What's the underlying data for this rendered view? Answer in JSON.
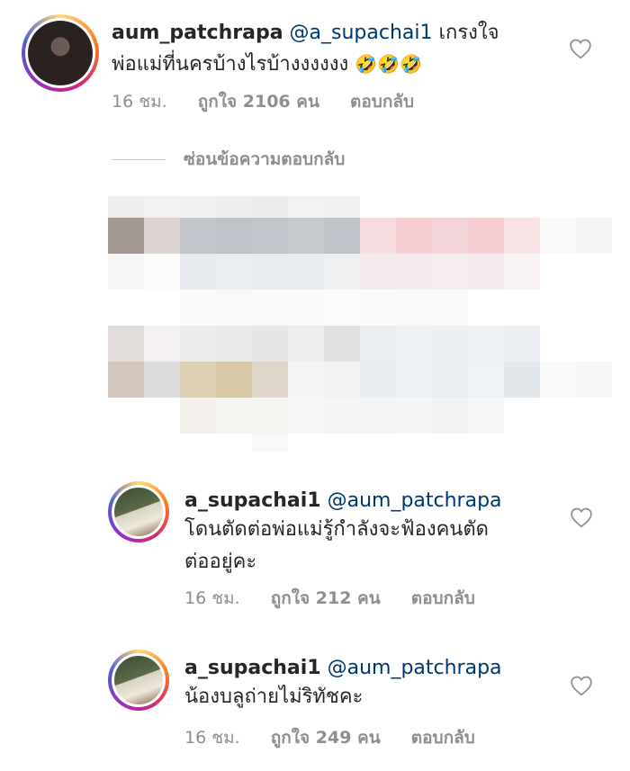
{
  "main_comment": {
    "username": "aum_patchrapa",
    "mention": "@a_supachai1",
    "text_line1": "เกรงใจ",
    "text_line2": "พ่อแม่ที่นครบ้างไรบ้างงงงงง",
    "emoji": "🤣🤣🤣",
    "time": "16 ชม.",
    "likes": "ถูกใจ 2106 คน",
    "reply_label": "ตอบกลับ"
  },
  "hide_replies_label": "ซ่อนข้อความตอบกลับ",
  "replies": [
    {
      "username": "a_supachai1",
      "mention": "@aum_patchrapa",
      "text_line1": "โดนตัดต่อพ่อแม่รู้กำลังจะฟ้องคนตัด",
      "text_line2": "ต่ออยู่คะ",
      "time": "16 ชม.",
      "likes": "ถูกใจ 212 คน",
      "reply_label": "ตอบกลับ"
    },
    {
      "username": "a_supachai1",
      "mention": "@aum_patchrapa",
      "text_line1": "น้องบลูถ่ายไม่ริทัชคะ",
      "time": "16 ชม.",
      "likes": "ถูกใจ 249 คน",
      "reply_label": "ตอบกลับ"
    }
  ],
  "colors": {
    "text": "#262626",
    "secondary": "#8e8e8e",
    "mention": "#00376b"
  },
  "icons": {
    "like": "heart-outline-icon"
  }
}
